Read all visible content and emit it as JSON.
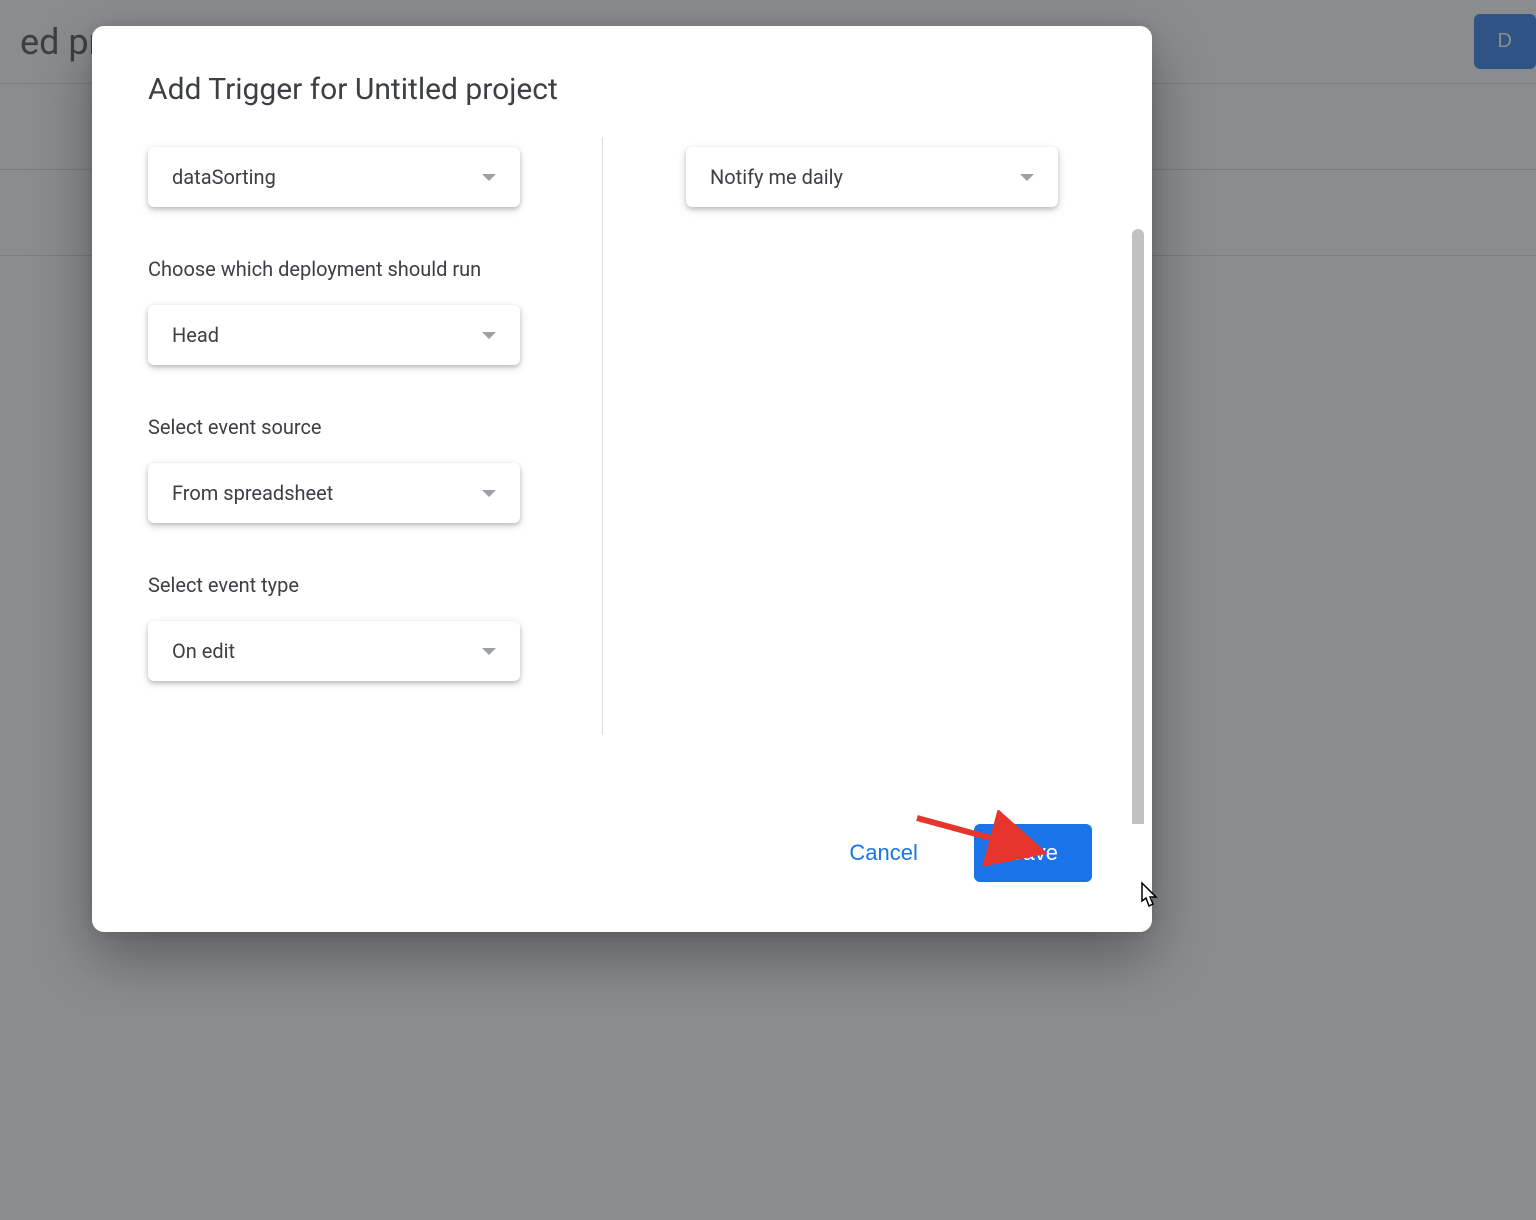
{
  "background": {
    "project_title": "ed project",
    "deploy_label": "D"
  },
  "modal": {
    "title": "Add Trigger for Untitled project",
    "left": {
      "function_value": "dataSorting",
      "deployment_label": "Choose which deployment should run",
      "deployment_value": "Head",
      "source_label": "Select event source",
      "source_value": "From spreadsheet",
      "type_label": "Select event type",
      "type_value": "On edit"
    },
    "right": {
      "notify_value": "Notify me daily"
    },
    "footer": {
      "cancel": "Cancel",
      "save": "Save"
    }
  }
}
